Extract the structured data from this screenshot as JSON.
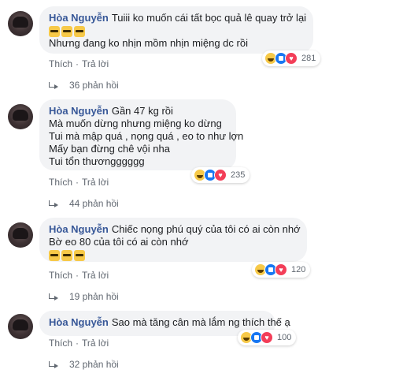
{
  "comments": [
    {
      "author": "Hòa Nguyễn",
      "lines": [
        "Tuiii ko muốn cái tất bọc quả lê quay trở lại",
        "Nhưng đang ko nhịn mồm nhịn miệng dc rồi"
      ],
      "emoji_count": 3,
      "emoji_icon": "bus-emoji-icon",
      "actions": {
        "like": "Thích",
        "reply": "Trả lời"
      },
      "reaction_count": "281",
      "replies": "36 phản hồi"
    },
    {
      "author": "Hòa Nguyễn",
      "lines": [
        "Gần 47 kg rồi",
        "Mà muốn dừng nhưng miệng ko dừng",
        "Tui mà mập quá , nọng quá , eo to như lợn",
        "Mấy bạn đừng chê vội nha",
        "Tui tổn thươngggggg"
      ],
      "actions": {
        "like": "Thích",
        "reply": "Trả lời"
      },
      "reaction_count": "235",
      "replies": "44 phản hồi"
    },
    {
      "author": "Hòa Nguyễn",
      "lines": [
        "Chiếc nọng phú quý của tôi có ai còn nhớ",
        "Bờ eo 80 của tôi có ai còn nhớ"
      ],
      "emoji_count": 3,
      "emoji_icon": "bus-emoji-icon",
      "actions": {
        "like": "Thích",
        "reply": "Trả lời"
      },
      "reaction_count": "120",
      "replies": "19 phản hồi"
    },
    {
      "author": "Hòa Nguyễn",
      "lines": [
        "Sao mà tăng cân mà lắm ng thích thế ạ"
      ],
      "actions": {
        "like": "Thích",
        "reply": "Trả lời"
      },
      "reaction_count": "100",
      "replies": "32 phản hồi"
    }
  ],
  "reaction_icons": [
    "haha-reaction-icon",
    "like-reaction-icon",
    "love-reaction-icon"
  ],
  "colors": {
    "name": "#385898",
    "bubble": "#f2f3f5",
    "meta": "#606770",
    "like": "#1877f2",
    "love": "#f33e58",
    "haha": "#f7c948"
  }
}
